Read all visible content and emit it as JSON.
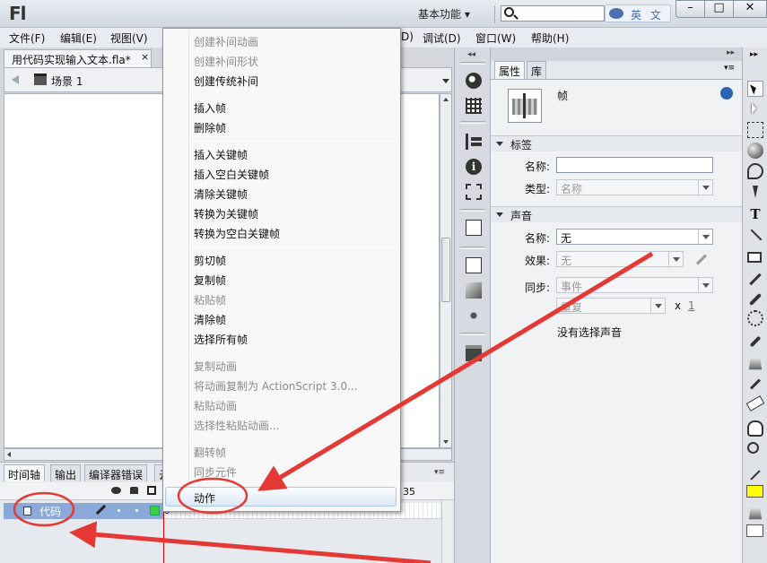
{
  "titlebar": {
    "logo": "Fl",
    "workspace_label": "基本功能 ▾",
    "search_placeholder": "",
    "ime_label": "英 文",
    "min": "–",
    "max": "□",
    "close": "✕"
  },
  "menubar": {
    "items": [
      "文件(F)",
      "编辑(E)",
      "视图(V)",
      "D)",
      "调试(D)",
      "窗口(W)",
      "帮助(H)"
    ]
  },
  "document": {
    "tab_title": "用代码实现输入文本.fla*",
    "tab_close": "×",
    "scene_label": "场景 1"
  },
  "timeline": {
    "tabs": [
      "时间轴",
      "输出",
      "编译器错误",
      "云"
    ],
    "frame_marker": "35",
    "layer_name": "代码"
  },
  "context_menu": {
    "items": [
      {
        "label": "创建补间动画",
        "disabled": true
      },
      {
        "label": "创建补间形状",
        "disabled": true
      },
      {
        "label": "创建传统补间",
        "disabled": false
      },
      {
        "label": "插入帧",
        "disabled": false
      },
      {
        "label": "删除帧",
        "disabled": false
      },
      {
        "label": "插入关键帧",
        "disabled": false
      },
      {
        "label": "插入空白关键帧",
        "disabled": false
      },
      {
        "label": "清除关键帧",
        "disabled": false
      },
      {
        "label": "转换为关键帧",
        "disabled": false
      },
      {
        "label": "转换为空白关键帧",
        "disabled": false
      },
      {
        "label": "剪切帧",
        "disabled": false
      },
      {
        "label": "复制帧",
        "disabled": false
      },
      {
        "label": "粘贴帧",
        "disabled": true
      },
      {
        "label": "清除帧",
        "disabled": false
      },
      {
        "label": "选择所有帧",
        "disabled": false
      },
      {
        "label": "复制动画",
        "disabled": true
      },
      {
        "label": "将动画复制为 ActionScript 3.0...",
        "disabled": true
      },
      {
        "label": "粘贴动画",
        "disabled": true
      },
      {
        "label": "选择性粘贴动画...",
        "disabled": true
      },
      {
        "label": "翻转帧",
        "disabled": true
      },
      {
        "label": "同步元件",
        "disabled": true
      }
    ],
    "highlighted": "动作"
  },
  "properties": {
    "tabs": [
      "属性",
      "库"
    ],
    "object_type": "帧",
    "label_section": "标签",
    "name_label": "名称:",
    "name_value": "",
    "type_label": "类型:",
    "type_value": "名称",
    "sound_section": "声音",
    "sound_name_label": "名称:",
    "sound_name_value": "无",
    "effect_label": "效果:",
    "effect_value": "无",
    "sync_label": "同步:",
    "sync_value": "事件",
    "repeat_value": "重复",
    "repeat_x": "x",
    "repeat_count": "1",
    "no_sound_text": "没有选择声音"
  },
  "colors": {
    "annotation_red": "#e53935",
    "layer_selected": "#8aa9d8",
    "fill_swatch": "#ffff00"
  },
  "icons": {
    "panel_strip": [
      "brush-icon",
      "swatches-icon",
      "align-icon",
      "info-icon",
      "transform-icon",
      "code-snippets-icon",
      "components-icon",
      "motion-presets-icon",
      "project-icon"
    ],
    "tools": [
      "selection-tool-icon",
      "subselection-tool-icon",
      "free-transform-tool-icon",
      "3d-rotation-tool-icon",
      "lasso-tool-icon",
      "pen-tool-icon",
      "text-tool-icon",
      "line-tool-icon",
      "rectangle-tool-icon",
      "pencil-tool-icon",
      "brush-tool-icon",
      "deco-tool-icon",
      "bone-tool-icon",
      "paint-bucket-tool-icon",
      "eyedropper-tool-icon",
      "eraser-tool-icon",
      "hand-tool-icon",
      "zoom-tool-icon"
    ]
  }
}
